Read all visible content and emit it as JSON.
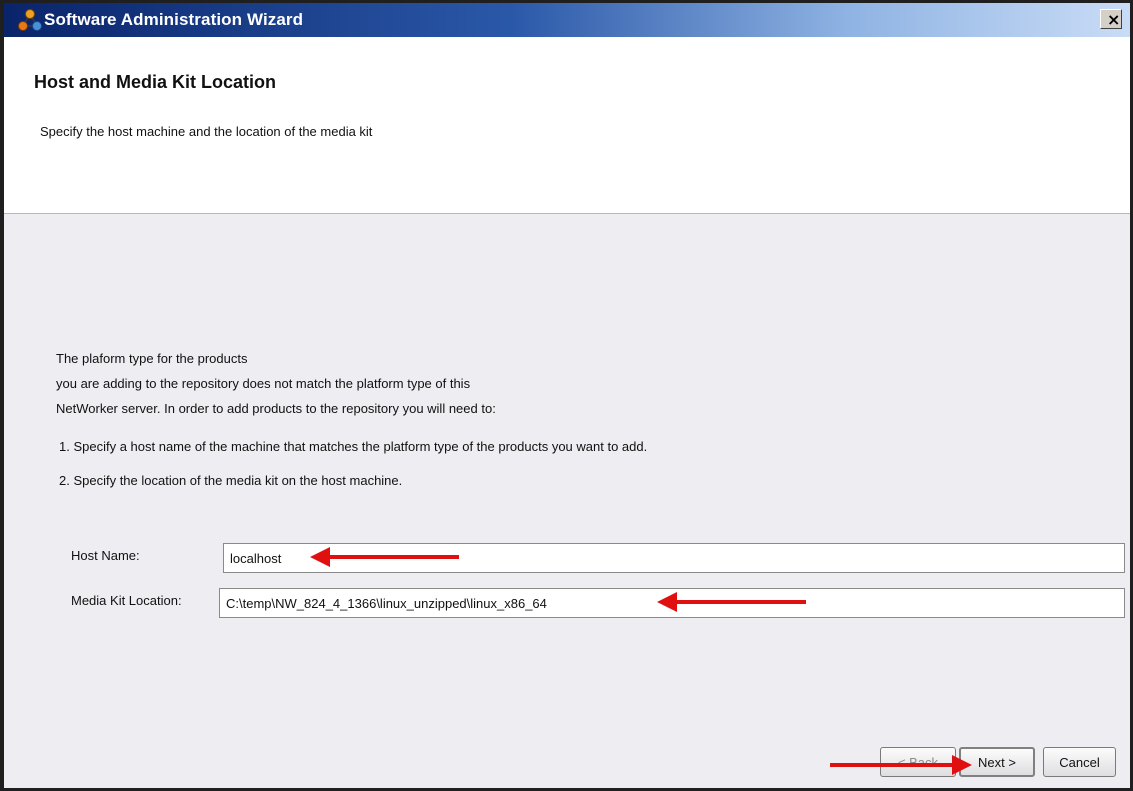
{
  "window": {
    "title": "Software Administration Wizard",
    "close_label": "×",
    "icon": "wizard-app-icon"
  },
  "header": {
    "title": "Host and Media Kit Location",
    "subtitle": "Specify the host machine and the location of the media kit"
  },
  "message": {
    "line1": "The plaform type for the products",
    "line2": "you are adding to the repository does not match the platform type of this",
    "line3": "NetWorker server. In order to add products to the repository you will need to:",
    "step1": "1. Specify a host name of the machine that matches the platform type of the products you want to add.",
    "step2": "2. Specify the location of the media kit on the host machine."
  },
  "form": {
    "host_name_label": "Host Name:",
    "host_name_value": "localhost",
    "media_kit_label": "Media Kit Location:",
    "media_kit_value": "C:\\temp\\NW_824_4_1366\\linux_unzipped\\linux_x86_64"
  },
  "buttons": {
    "back": "< Back",
    "next": "Next >",
    "cancel": "Cancel"
  },
  "colors": {
    "annotation_arrow": "#e01010",
    "content_background": "#eeeef2"
  }
}
